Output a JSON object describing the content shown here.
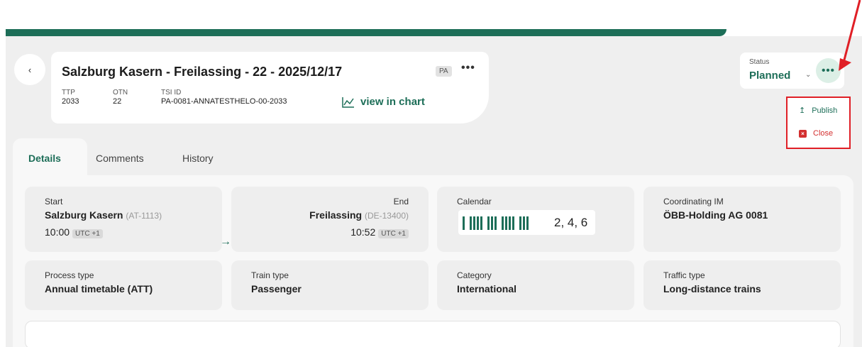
{
  "header": {
    "back_icon": "chevron-left-icon",
    "title": "Salzburg Kasern - Freilassing - 22 - 2025/12/17",
    "badge": "PA",
    "more_label": "•••",
    "meta": [
      {
        "label": "TTP",
        "value": "2033"
      },
      {
        "label": "OTN",
        "value": "22"
      },
      {
        "label": "TSI ID",
        "value": "PA-0081-ANNATESTHELO-00-2033"
      }
    ],
    "view_chart_label": "view in chart",
    "view_chart_icon": "line-chart-icon"
  },
  "status": {
    "label": "Status",
    "value": "Planned",
    "more_label": "•••"
  },
  "dropdown": {
    "items": [
      {
        "label": "Publish",
        "icon": "upload-icon",
        "color": "#1d6e58"
      },
      {
        "label": "Close",
        "icon": "close-box-icon",
        "color": "#d32f2f"
      }
    ],
    "highlight_color": "#e01f26"
  },
  "tabs": [
    {
      "label": "Details",
      "active": true
    },
    {
      "label": "Comments",
      "active": false
    },
    {
      "label": "History",
      "active": false
    }
  ],
  "route": {
    "start": {
      "label": "Start",
      "station": "Salzburg Kasern",
      "code": "(AT-1113)",
      "time": "10:00",
      "tz": "UTC +1"
    },
    "end": {
      "label": "End",
      "station": "Freilassing",
      "code": "(DE-13400)",
      "time": "10:52",
      "tz": "UTC +1"
    },
    "arrow": "→"
  },
  "calendar": {
    "label": "Calendar",
    "days": "2, 4, 6"
  },
  "coordinating_im": {
    "label": "Coordinating IM",
    "value": "ÖBB-Holding AG 0081"
  },
  "process_type": {
    "label": "Process type",
    "value": "Annual timetable (ATT)"
  },
  "train_type": {
    "label": "Train type",
    "value": "Passenger"
  },
  "category": {
    "label": "Category",
    "value": "International"
  },
  "traffic_type": {
    "label": "Traffic type",
    "value": "Long-distance trains"
  },
  "colors": {
    "brand": "#1d6e58",
    "danger": "#d32f2f",
    "annotation": "#e01f26"
  }
}
